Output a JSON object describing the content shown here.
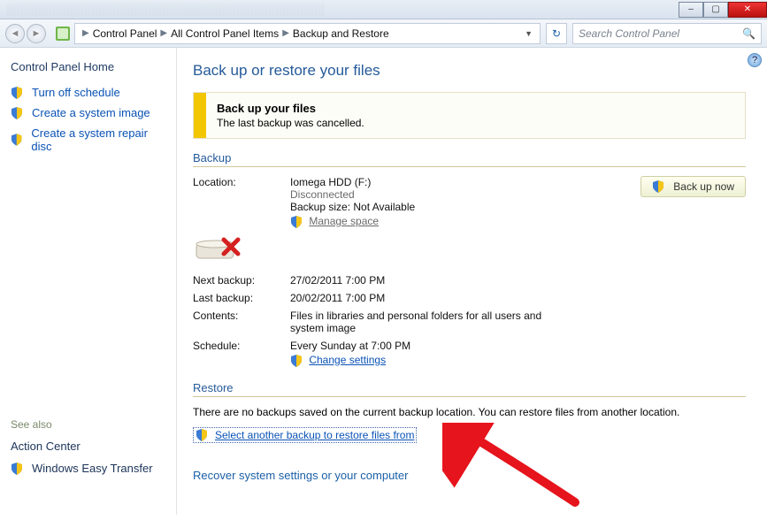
{
  "window": {
    "min": "–",
    "max": "▢",
    "close": "✕"
  },
  "nav": {
    "crumbs": [
      "Control Panel",
      "All Control Panel Items",
      "Backup and Restore"
    ],
    "search_placeholder": "Search Control Panel"
  },
  "sidebar": {
    "home": "Control Panel Home",
    "items": [
      {
        "label": "Turn off schedule"
      },
      {
        "label": "Create a system image"
      },
      {
        "label": "Create a system repair disc"
      }
    ],
    "see_also_title": "See also",
    "see_also": [
      "Action Center",
      "Windows Easy Transfer"
    ]
  },
  "main": {
    "title": "Back up or restore your files",
    "alert": {
      "title": "Back up your files",
      "msg": "The last backup was cancelled."
    },
    "backup_section": {
      "heading": "Backup",
      "location_label": "Location:",
      "location_value": "Iomega HDD (F:)",
      "status": "Disconnected",
      "size_label": "Backup size: Not Available",
      "manage_space": "Manage space",
      "backup_now": "Back up now",
      "next_label": "Next backup:",
      "next_value": "27/02/2011 7:00 PM",
      "last_label": "Last backup:",
      "last_value": "20/02/2011 7:00 PM",
      "contents_label": "Contents:",
      "contents_value": "Files in libraries and personal folders for all users and system image",
      "schedule_label": "Schedule:",
      "schedule_value": "Every Sunday at 7:00 PM",
      "change_settings": "Change settings"
    },
    "restore_section": {
      "heading": "Restore",
      "msg": "There are no backups saved on the current backup location. You can restore files from another location.",
      "select_link": "Select another backup to restore files from",
      "recover": "Recover system settings or your computer"
    }
  }
}
